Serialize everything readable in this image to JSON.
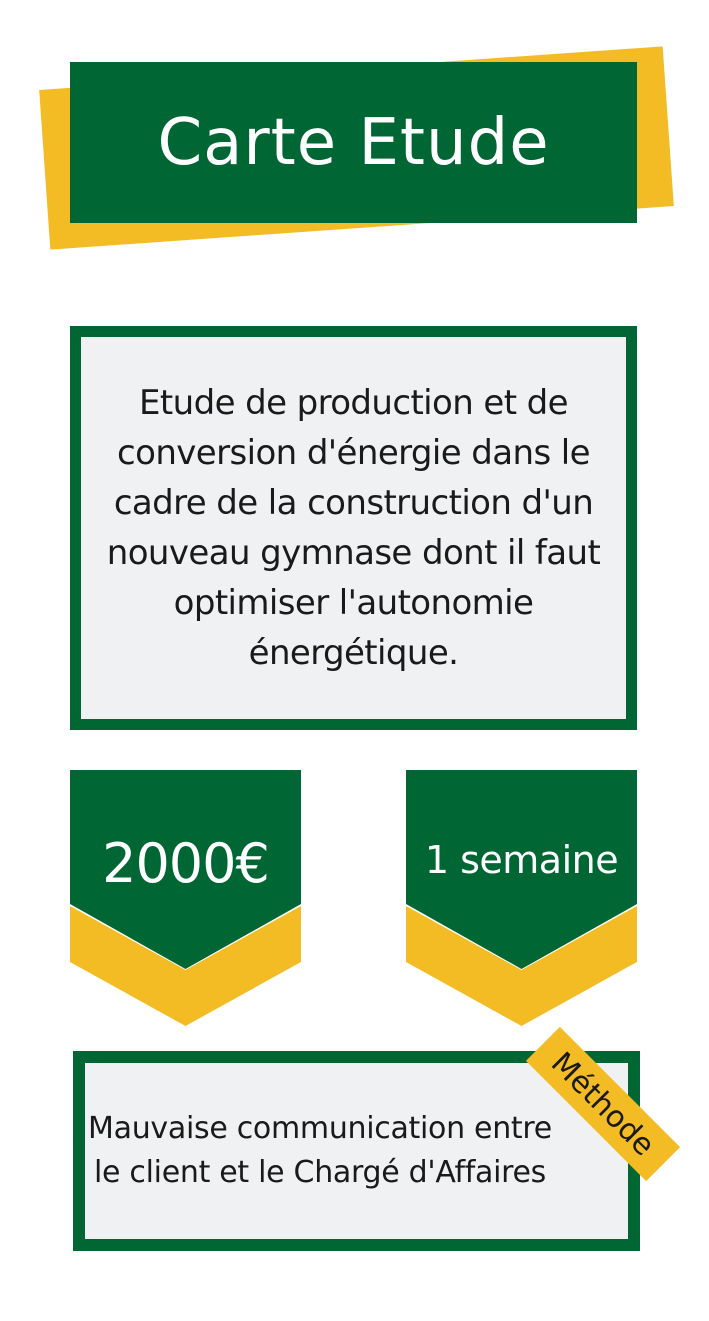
{
  "title": "Carte Etude",
  "description": "Etude de production et de conversion d'énergie dans le cadre de la construction d'un nouveau gymnase dont il faut optimiser l'autonomie énergétique.",
  "price": "2000€",
  "duration": "1 semaine",
  "method": {
    "tag": "Méthode",
    "text": "Mauvaise communication entre le client et le Chargé d'Affaires"
  },
  "colors": {
    "green": "#006633",
    "yellow": "#f3bb24",
    "panel": "#f0f1f3"
  }
}
